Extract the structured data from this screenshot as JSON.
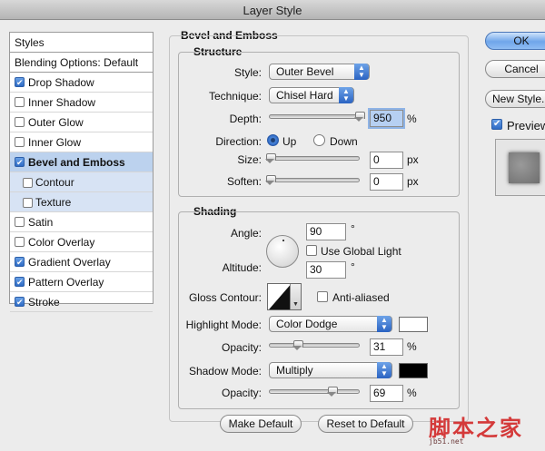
{
  "window": {
    "title": "Layer Style"
  },
  "styles_list": {
    "header": "Styles",
    "blending": "Blending Options: Default",
    "items": [
      {
        "label": "Drop Shadow",
        "checked": true
      },
      {
        "label": "Inner Shadow",
        "checked": false
      },
      {
        "label": "Outer Glow",
        "checked": false
      },
      {
        "label": "Inner Glow",
        "checked": false
      },
      {
        "label": "Bevel and Emboss",
        "checked": true,
        "selected": true
      },
      {
        "label": "Contour",
        "checked": false,
        "sub": true
      },
      {
        "label": "Texture",
        "checked": false,
        "sub": true
      },
      {
        "label": "Satin",
        "checked": false
      },
      {
        "label": "Color Overlay",
        "checked": false
      },
      {
        "label": "Gradient Overlay",
        "checked": true
      },
      {
        "label": "Pattern Overlay",
        "checked": true
      },
      {
        "label": "Stroke",
        "checked": true
      }
    ]
  },
  "bevel": {
    "title": "Bevel and Emboss",
    "structure": {
      "title": "Structure",
      "style_label": "Style:",
      "style_value": "Outer Bevel",
      "technique_label": "Technique:",
      "technique_value": "Chisel Hard",
      "depth_label": "Depth:",
      "depth_value": "950",
      "depth_unit": "%",
      "depth_level": 1.0,
      "direction_label": "Direction:",
      "direction_up": "Up",
      "direction_down": "Down",
      "direction_selected": "Up",
      "size_label": "Size:",
      "size_value": "0",
      "size_unit": "px",
      "size_level": 0.0,
      "soften_label": "Soften:",
      "soften_value": "0",
      "soften_unit": "px",
      "soften_level": 0.0
    },
    "shading": {
      "title": "Shading",
      "angle_label": "Angle:",
      "angle_value": "90",
      "angle_unit": "°",
      "use_global_light": "Use Global Light",
      "use_global_light_checked": false,
      "altitude_label": "Altitude:",
      "altitude_value": "30",
      "altitude_unit": "°",
      "gloss_label": "Gloss Contour:",
      "anti_aliased": "Anti-aliased",
      "anti_aliased_checked": false,
      "highlight_mode_label": "Highlight Mode:",
      "highlight_mode_value": "Color Dodge",
      "highlight_color": "#ffffff",
      "highlight_opacity_label": "Opacity:",
      "highlight_opacity_value": "31",
      "highlight_opacity_unit": "%",
      "highlight_opacity_level": 0.31,
      "shadow_mode_label": "Shadow Mode:",
      "shadow_mode_value": "Multiply",
      "shadow_color": "#000000",
      "shadow_opacity_label": "Opacity:",
      "shadow_opacity_value": "69",
      "shadow_opacity_unit": "%",
      "shadow_opacity_level": 0.69
    },
    "make_default": "Make Default",
    "reset_default": "Reset to Default"
  },
  "buttons": {
    "ok": "OK",
    "cancel": "Cancel",
    "new_style": "New Style...",
    "preview": "Preview",
    "preview_checked": true
  },
  "watermark": {
    "main": "脚本之家",
    "url": "jb51.net"
  }
}
